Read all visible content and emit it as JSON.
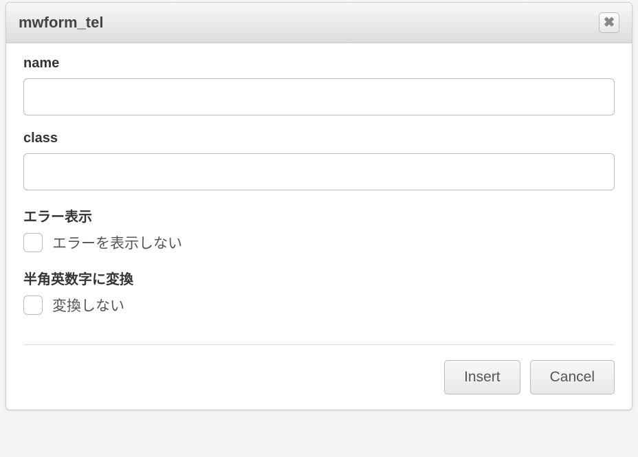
{
  "dialog": {
    "title": "mwform_tel"
  },
  "fields": {
    "name": {
      "label": "name",
      "value": ""
    },
    "class": {
      "label": "class",
      "value": ""
    },
    "error_display": {
      "label": "エラー表示",
      "checkbox_label": "エラーを表示しない"
    },
    "convert": {
      "label": "半角英数字に変換",
      "checkbox_label": "変換しない"
    }
  },
  "buttons": {
    "insert": "Insert",
    "cancel": "Cancel"
  }
}
